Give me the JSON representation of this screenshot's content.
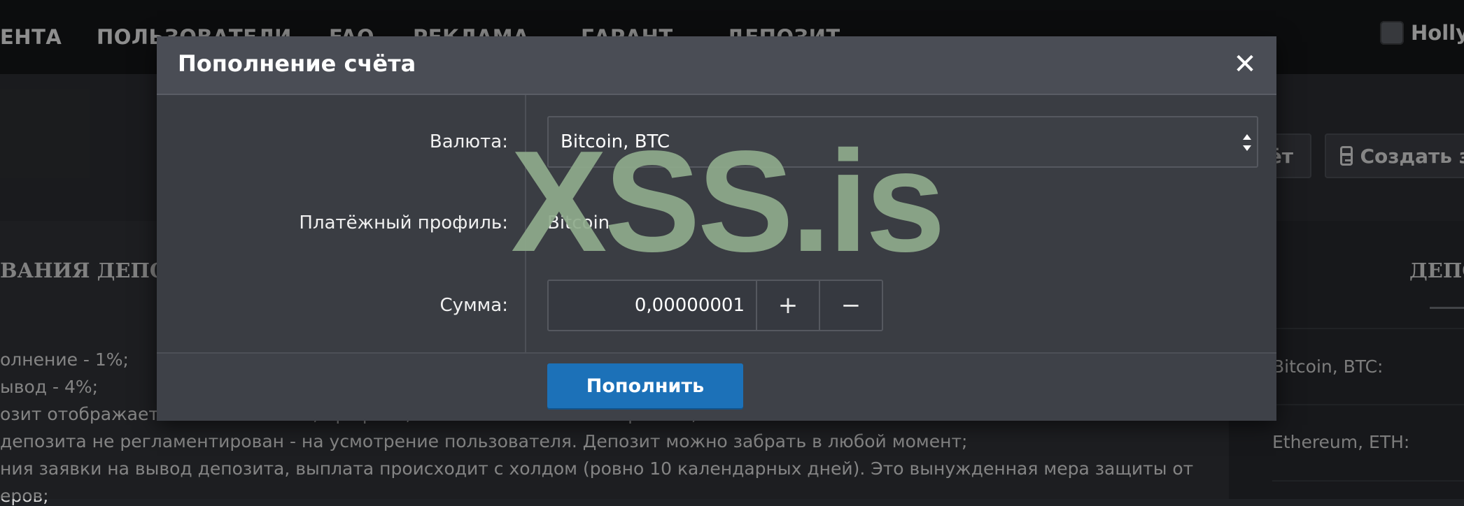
{
  "topnav": {
    "items": [
      {
        "label": "ЕНТА"
      },
      {
        "label": "ПОЛЬЗОВАТЕЛИ"
      },
      {
        "label": "FAQ"
      },
      {
        "label": "РЕКЛАМА"
      },
      {
        "label": "ГАРАНТ"
      },
      {
        "label": "ДЕПОЗИТ"
      }
    ],
    "username": "Hollyw"
  },
  "toolbar": {
    "btn_account_partial": "ёт",
    "btn_create_partial": "Создать з"
  },
  "content": {
    "title_partial": "ВАНИЯ ДЕПОЗ",
    "lines": [
      "олнение - 1%;",
      "ывод - 4%;",
      "озит отображается во всех темах, профиле, а также всех ваших сервисах;",
      "депозита не регламентирован - на усмотрение пользователя. Депозит можно забрать в любой момент;",
      "ния заявки на вывод депозита, выплата происходит с холдом (ровно 10 календарных дней). Это вынужденная мера защиты от",
      "еров;"
    ]
  },
  "sidebar": {
    "title_partial": "ДЕПО",
    "rows": [
      {
        "label": "Bitcoin, BTC:"
      },
      {
        "label": "Ethereum, ETH:"
      }
    ]
  },
  "modal": {
    "title": "Пополнение счёта",
    "close_symbol": "✕",
    "currency_label": "Валюта:",
    "currency_value": "Bitcoin, BTC",
    "profile_label": "Платёжный профиль:",
    "profile_value": "Bitcoin",
    "amount_label": "Сумма:",
    "amount_value": "0,00000001",
    "plus_symbol": "+",
    "minus_symbol": "−",
    "submit_label": "Пополнить"
  },
  "watermark": "XSS.is"
}
